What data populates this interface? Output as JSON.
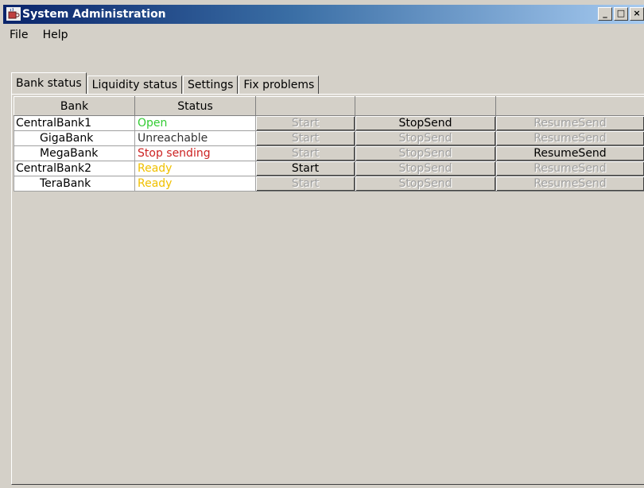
{
  "window": {
    "title": "System Administration"
  },
  "menu": [
    "File",
    "Help"
  ],
  "tabs": [
    "Bank status",
    "Liquidity status",
    "Settings",
    "Fix problems"
  ],
  "table": {
    "headers": [
      "Bank",
      "Status",
      "",
      "",
      ""
    ],
    "rows": [
      {
        "bank": "CentralBank1",
        "indent": false,
        "status": "Open",
        "status_color": "#33cc33",
        "start": "Start",
        "start_enabled": false,
        "stop": "StopSend",
        "stop_enabled": true,
        "resume": "ResumeSend",
        "resume_enabled": false
      },
      {
        "bank": "GigaBank",
        "indent": true,
        "status": "Unreachable",
        "status_color": "#333333",
        "start": "Start",
        "start_enabled": false,
        "stop": "StopSend",
        "stop_enabled": false,
        "resume": "ResumeSend",
        "resume_enabled": false
      },
      {
        "bank": "MegaBank",
        "indent": true,
        "status": "Stop sending",
        "status_color": "#cc2222",
        "start": "Start",
        "start_enabled": false,
        "stop": "StopSend",
        "stop_enabled": false,
        "resume": "ResumeSend",
        "resume_enabled": true
      },
      {
        "bank": "CentralBank2",
        "indent": false,
        "status": "Ready",
        "status_color": "#f0c000",
        "start": "Start",
        "start_enabled": true,
        "stop": "StopSend",
        "stop_enabled": false,
        "resume": "ResumeSend",
        "resume_enabled": false
      },
      {
        "bank": "TeraBank",
        "indent": true,
        "status": "Ready",
        "status_color": "#f0c000",
        "start": "Start",
        "start_enabled": false,
        "stop": "StopSend",
        "stop_enabled": false,
        "resume": "ResumeSend",
        "resume_enabled": false
      }
    ]
  },
  "icons": {
    "app": "coffee-cup-icon",
    "minimize": "minimize-icon",
    "maximize": "maximize-icon",
    "close": "close-icon"
  }
}
